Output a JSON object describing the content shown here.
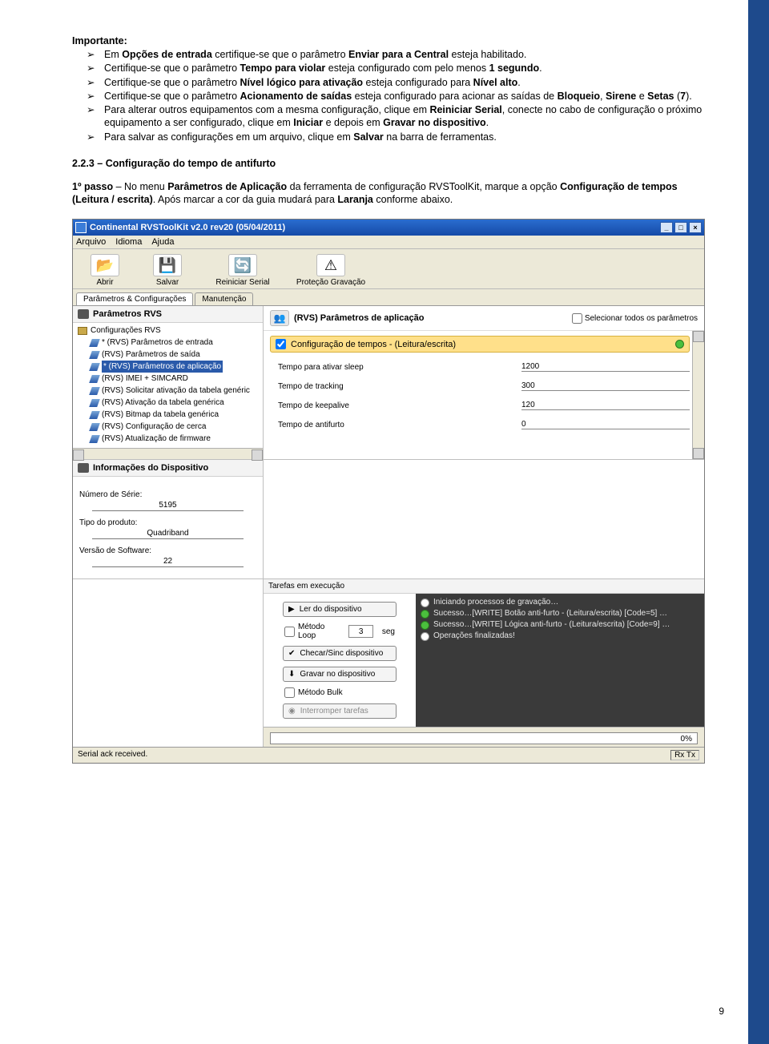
{
  "doc": {
    "important_title": "Importante:",
    "bullets": [
      "Em <b>Opções de entrada</b> certifique-se que o parâmetro <b>Enviar para a Central</b> esteja habilitado.",
      "Certifique-se que o parâmetro <b>Tempo para violar</b> esteja configurado com pelo menos <b>1 segundo</b>.",
      "Certifique-se que o parâmetro <b>Nível lógico para ativação</b> esteja configurado para <b>Nível alto</b>.",
      "Certifique-se que o parâmetro <b>Acionamento de saídas</b> esteja configurado para acionar as saídas de <b>Bloqueio</b>, <b>Sirene</b> e <b>Setas</b> (<b>7</b>).",
      "Para alterar outros equipamentos com a mesma configuração, clique em <b>Reiniciar Serial</b>, conecte no cabo de configuração o próximo equipamento a ser configurado, clique em <b>Iniciar</b> e depois em <b>Gravar no dispositivo</b>.",
      "Para salvar as configurações em um arquivo, clique em <b>Salvar</b> na barra de ferramentas."
    ],
    "section_heading": "2.2.3 – Configuração do tempo de antifurto",
    "passo_html": "<b>1º passo</b> – No menu <b>Parâmetros de Aplicação</b> da ferramenta de configuração RVSToolKit, marque a opção <b>Configuração de tempos (Leitura / escrita)</b>. Após marcar a cor da guia mudará para <b>Laranja</b> conforme abaixo.",
    "page_number": "9"
  },
  "app": {
    "title": "Continental RVSToolKit v2.0 rev20 (05/04/2011)",
    "menus": [
      "Arquivo",
      "Idioma",
      "Ajuda"
    ],
    "toolbar": [
      {
        "id": "abrir",
        "label": "Abrir",
        "glyph": "📂"
      },
      {
        "id": "salvar",
        "label": "Salvar",
        "glyph": "💾"
      },
      {
        "id": "reiniciar",
        "label": "Reiniciar Serial",
        "glyph": "🔄"
      },
      {
        "id": "protecao",
        "label": "Proteção Gravação",
        "glyph": "⚠"
      }
    ],
    "tabs": [
      "Parâmetros & Configurações",
      "Manutenção"
    ],
    "left_panel_title": "Parâmetros RVS",
    "tree_root": "Configurações RVS",
    "tree_items": [
      "* (RVS) Parâmetros de entrada",
      "(RVS) Parâmetros de saída",
      "* (RVS) Parâmetros de aplicação",
      "(RVS) IMEI + SIMCARD",
      "(RVS) Solicitar ativação da tabela genéric",
      "(RVS) Ativação da tabela genérica",
      "(RVS) Bitmap da tabela genérica",
      "(RVS) Configuração de cerca",
      "(RVS) Atualização de firmware"
    ],
    "tree_selected_index": 2,
    "info_panel_title": "Informações do Dispositivo",
    "info": {
      "serie_label": "Número de Série:",
      "serie_value": "5195",
      "tipo_label": "Tipo do produto:",
      "tipo_value": "Quadriband",
      "versao_label": "Versão de Software:",
      "versao_value": "22"
    },
    "right_title": "(RVS) Parâmetros de aplicação",
    "select_all": "Selecionar todos os parâmetros",
    "group_label": "Configuração de tempos - (Leitura/escrita)",
    "params": [
      {
        "label": "Tempo para ativar sleep",
        "value": "1200"
      },
      {
        "label": "Tempo de tracking",
        "value": "300"
      },
      {
        "label": "Tempo de keepalive",
        "value": "120"
      },
      {
        "label": "Tempo de antifurto",
        "value": "0"
      }
    ],
    "tasks_header": "Tarefas em execução",
    "buttons": {
      "ler": "Ler do dispositivo",
      "loop": "Método Loop",
      "loop_val": "3",
      "loop_unit": "seg",
      "checar": "Checar/Sinc dispositivo",
      "gravar": "Gravar no dispositivo",
      "bulk": "Método Bulk",
      "interromper": "Interromper tarefas"
    },
    "log": [
      {
        "kind": "i",
        "text": "Iniciando processos de gravação…"
      },
      {
        "kind": "g",
        "text": "Sucesso…[WRITE] Botão anti-furto - (Leitura/escrita) [Code=5] …"
      },
      {
        "kind": "g",
        "text": "Sucesso…[WRITE] Lógica anti-furto - (Leitura/escrita) [Code=9] …"
      },
      {
        "kind": "i",
        "text": "Operações finalizadas!"
      }
    ],
    "progress_text": "0%",
    "status_text": "Serial ack received.",
    "rxtx": "Rx Tx"
  }
}
